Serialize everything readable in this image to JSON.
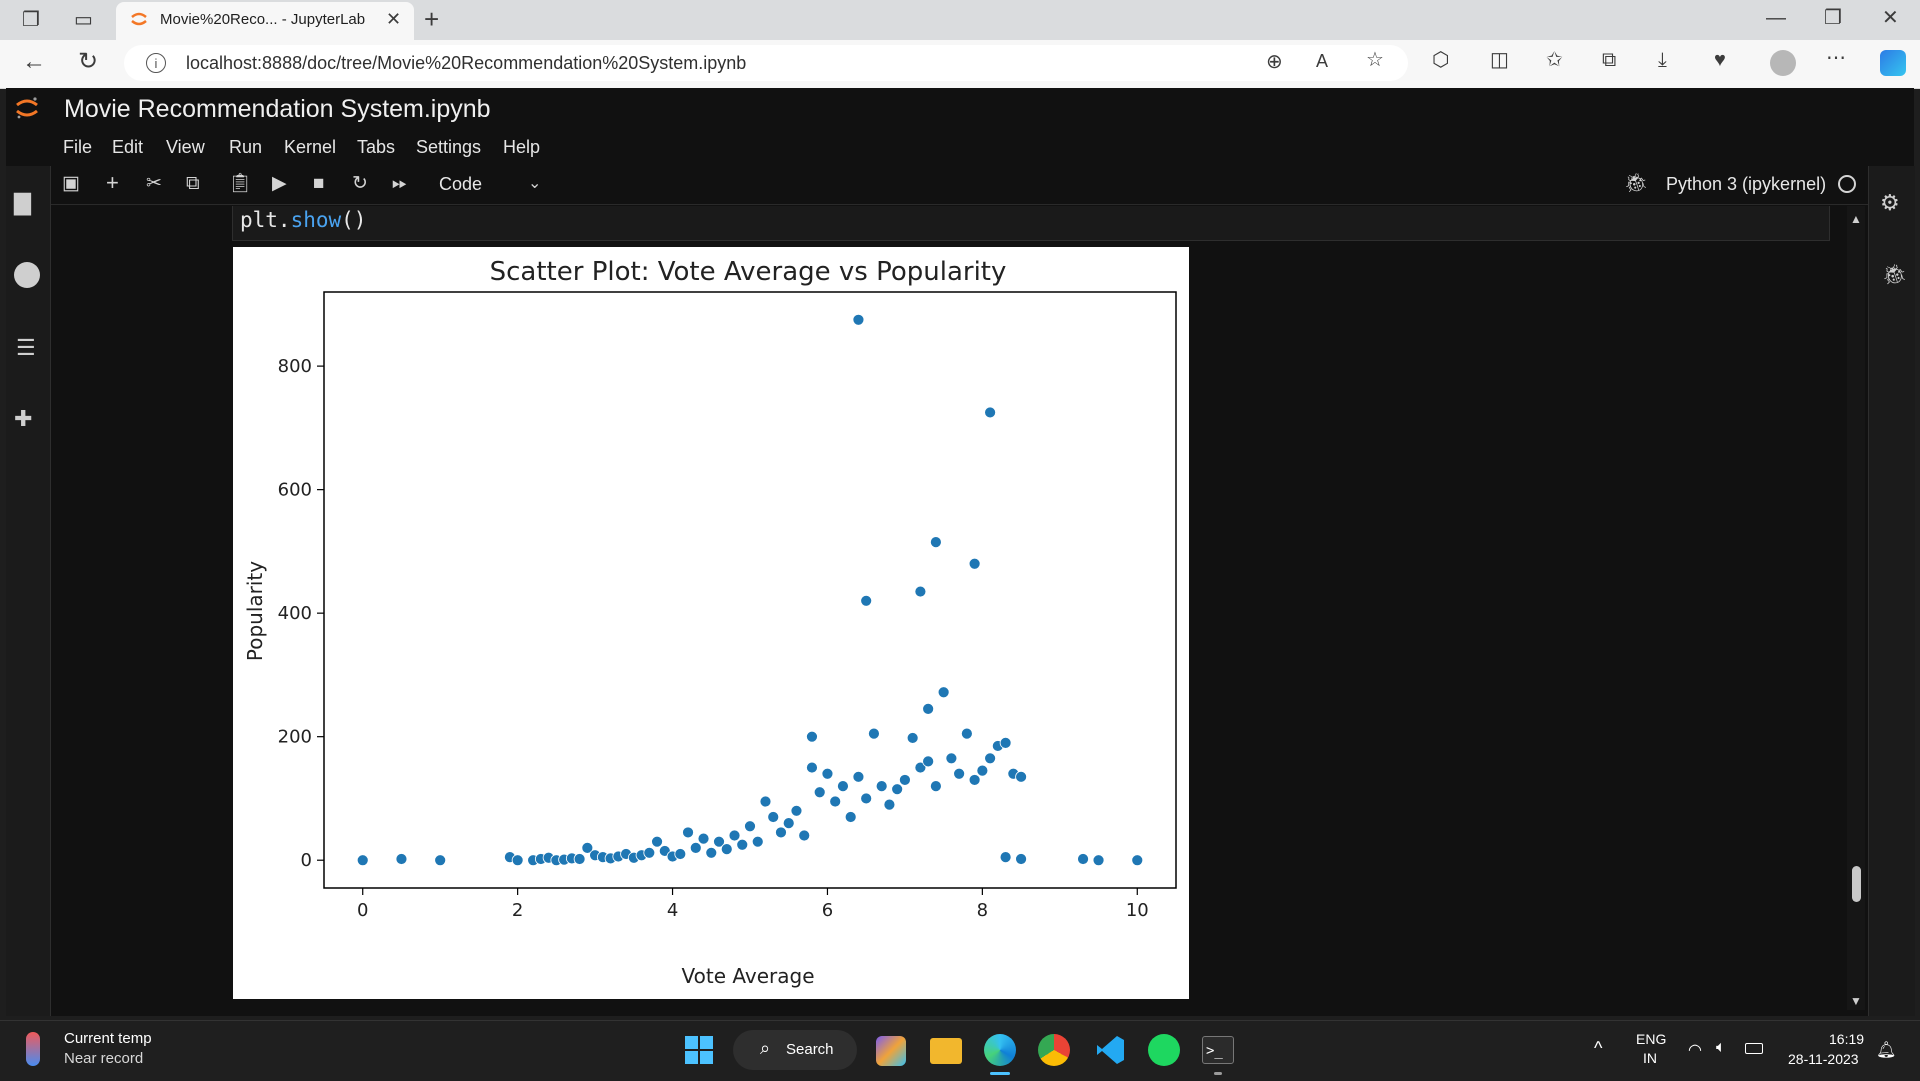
{
  "browser": {
    "tab_title": "Movie%20Reco... - JupyterLab",
    "url": "localhost:8888/doc/tree/Movie%20Recommendation%20System.ipynb"
  },
  "jupyter": {
    "title": "Movie Recommendation System.ipynb",
    "menu": [
      "File",
      "Edit",
      "View",
      "Run",
      "Kernel",
      "Tabs",
      "Settings",
      "Help"
    ],
    "cell_type": "Code",
    "kernel": "Python 3 (ipykernel)",
    "code": {
      "obj": "plt.",
      "fn": "show",
      "args": "()"
    }
  },
  "chart_data": {
    "type": "scatter",
    "title": "Scatter Plot: Vote Average vs Popularity",
    "xlabel": "Vote Average",
    "ylabel": "Popularity",
    "xlim": [
      -0.5,
      10.5
    ],
    "ylim": [
      -45,
      920
    ],
    "xticks": [
      0,
      2,
      4,
      6,
      8,
      10
    ],
    "yticks": [
      0,
      200,
      400,
      600,
      800
    ],
    "color": "#1f77b4",
    "points": [
      [
        0,
        0
      ],
      [
        0.5,
        2
      ],
      [
        1,
        0
      ],
      [
        1.9,
        5
      ],
      [
        2,
        0
      ],
      [
        2.2,
        0
      ],
      [
        2.3,
        2
      ],
      [
        2.4,
        4
      ],
      [
        2.5,
        0
      ],
      [
        2.6,
        1
      ],
      [
        2.7,
        3
      ],
      [
        2.8,
        2
      ],
      [
        2.9,
        20
      ],
      [
        3.0,
        8
      ],
      [
        3.1,
        5
      ],
      [
        3.2,
        3
      ],
      [
        3.3,
        6
      ],
      [
        3.4,
        10
      ],
      [
        3.5,
        4
      ],
      [
        3.6,
        8
      ],
      [
        3.7,
        12
      ],
      [
        3.8,
        30
      ],
      [
        3.9,
        15
      ],
      [
        4.0,
        6
      ],
      [
        4.1,
        10
      ],
      [
        4.2,
        45
      ],
      [
        4.3,
        20
      ],
      [
        4.4,
        35
      ],
      [
        4.5,
        12
      ],
      [
        4.6,
        30
      ],
      [
        4.7,
        18
      ],
      [
        4.8,
        40
      ],
      [
        4.9,
        25
      ],
      [
        5.0,
        55
      ],
      [
        5.1,
        30
      ],
      [
        5.2,
        95
      ],
      [
        5.3,
        70
      ],
      [
        5.4,
        45
      ],
      [
        5.5,
        60
      ],
      [
        5.6,
        80
      ],
      [
        5.7,
        40
      ],
      [
        5.8,
        150
      ],
      [
        5.9,
        110
      ],
      [
        6.0,
        140
      ],
      [
        6.1,
        95
      ],
      [
        6.2,
        120
      ],
      [
        6.3,
        70
      ],
      [
        6.4,
        135
      ],
      [
        6.5,
        100
      ],
      [
        6.6,
        205
      ],
      [
        6.7,
        120
      ],
      [
        6.8,
        90
      ],
      [
        6.9,
        115
      ],
      [
        7.0,
        130
      ],
      [
        7.1,
        198
      ],
      [
        7.2,
        150
      ],
      [
        7.3,
        160
      ],
      [
        7.4,
        120
      ],
      [
        7.5,
        272
      ],
      [
        7.6,
        165
      ],
      [
        7.7,
        140
      ],
      [
        7.8,
        205
      ],
      [
        7.9,
        130
      ],
      [
        8.0,
        145
      ],
      [
        8.1,
        165
      ],
      [
        8.2,
        185
      ],
      [
        8.3,
        190
      ],
      [
        8.4,
        140
      ],
      [
        8.5,
        135
      ],
      [
        5.8,
        200
      ],
      [
        6.5,
        420
      ],
      [
        6.4,
        875
      ],
      [
        7.2,
        435
      ],
      [
        7.4,
        515
      ],
      [
        7.9,
        480
      ],
      [
        8.1,
        725
      ],
      [
        7.3,
        245
      ],
      [
        9.3,
        2
      ],
      [
        9.5,
        0
      ],
      [
        10,
        0
      ],
      [
        8.3,
        5
      ],
      [
        8.5,
        2
      ]
    ]
  },
  "taskbar": {
    "weather_title": "Current temp",
    "weather_sub": "Near record",
    "search": "Search",
    "lang_top": "ENG",
    "lang_bottom": "IN",
    "time": "16:19",
    "date": "28-11-2023"
  }
}
